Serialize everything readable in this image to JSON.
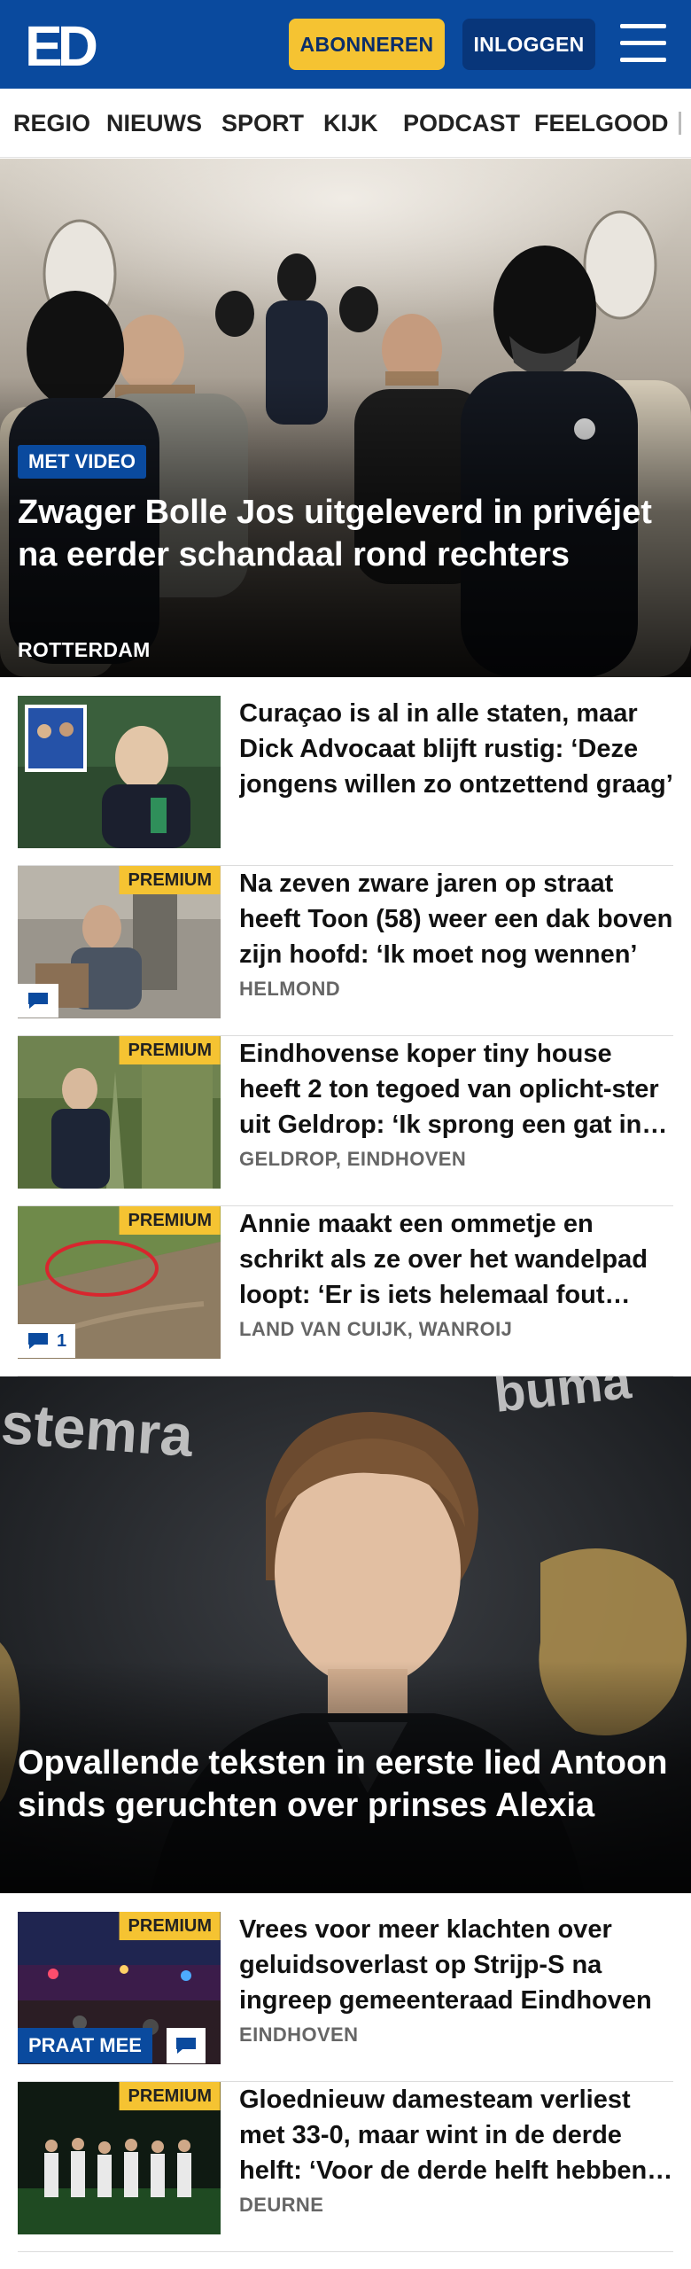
{
  "header": {
    "logo_text": "ED",
    "subscribe_label": "ABONNEREN",
    "login_label": "INLOGGEN",
    "menu_icon": "hamburger-menu-icon",
    "brand_color": "#0a4a9e",
    "accent_color": "#f5c332"
  },
  "nav": {
    "items": [
      "REGIO",
      "NIEUWS",
      "SPORT",
      "KIJK",
      "PODCAST",
      "FEELGOOD"
    ]
  },
  "hero1": {
    "badge": "MET VIDEO",
    "title": "Zwager Bolle Jos uitgeleverd in privéjet na eerder schandaal rond rechters",
    "location": "ROTTERDAM"
  },
  "articles1": [
    {
      "title": "Curaçao is al in alle staten, maar Dick Advocaat blijft rustig: ‘Deze jongens willen zo ontzettend graag’",
      "location": "",
      "premium": ""
    },
    {
      "title": "Na zeven zware jaren op straat heeft Toon (58) weer een dak boven zijn hoofd: ‘Ik moet nog wennen’",
      "location": "HELMOND",
      "premium": "PREMIUM",
      "comments": ""
    },
    {
      "title": "Eindhovense koper tiny house heeft 2 ton tegoed van oplicht-ster uit Geldrop: ‘Ik sprong een gat in de lucht’",
      "location": "GELDROP, EINDHOVEN",
      "premium": "PREMIUM"
    },
    {
      "title": "Annie maakt een ommetje en schrikt als ze over het wandelpad loopt: ‘Er is iets helemaal fout gegaan’",
      "location": "LAND VAN CUIJK, WANROIJ",
      "premium": "PREMIUM",
      "comments": "1"
    }
  ],
  "hero2": {
    "title": "Opvallende teksten in eerste lied Antoon sinds geruchten over prinses Alexia",
    "bg_word_left": "stemra",
    "bg_word_right": "buma"
  },
  "articles2": [
    {
      "title": "Vrees voor meer klachten over geluidsoverlast op Strijp-S na ingreep gemeenteraad Eindhoven",
      "location": "EINDHOVEN",
      "premium": "PREMIUM",
      "praat_label": "PRAAT MEE"
    },
    {
      "title": "Gloednieuw damesteam verliest met 33-0, maar wint in de derde helft: ‘Voor de derde helft hebben we getraind’",
      "location": "DEURNE",
      "premium": "PREMIUM"
    }
  ]
}
